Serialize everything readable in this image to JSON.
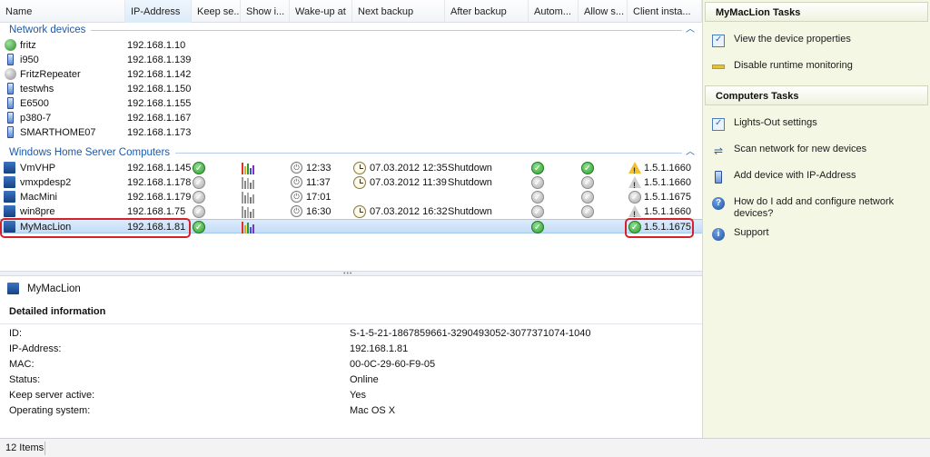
{
  "columns": [
    {
      "key": "name",
      "label": "Name"
    },
    {
      "key": "ip",
      "label": "IP-Address"
    },
    {
      "key": "keep",
      "label": "Keep se..."
    },
    {
      "key": "show",
      "label": "Show i..."
    },
    {
      "key": "wake",
      "label": "Wake-up at"
    },
    {
      "key": "next_backup",
      "label": "Next backup"
    },
    {
      "key": "after_backup",
      "label": "After backup"
    },
    {
      "key": "autom",
      "label": "Autom..."
    },
    {
      "key": "allow",
      "label": "Allow s..."
    },
    {
      "key": "client",
      "label": "Client insta..."
    }
  ],
  "sorted_column": "IP-Address",
  "groups": {
    "network": {
      "title": "Network devices",
      "rows": [
        {
          "name": "fritz",
          "ip": "192.168.1.10",
          "icon": "globe-device-icon"
        },
        {
          "name": "i950",
          "ip": "192.168.1.139",
          "icon": "device-icon"
        },
        {
          "name": "FritzRepeater",
          "ip": "192.168.1.142",
          "icon": "search-device-icon"
        },
        {
          "name": "testwhs",
          "ip": "192.168.1.150",
          "icon": "device-icon"
        },
        {
          "name": "E6500",
          "ip": "192.168.1.155",
          "icon": "device-icon"
        },
        {
          "name": "p380-7",
          "ip": "192.168.1.167",
          "icon": "device-icon"
        },
        {
          "name": "SMARTHOME07",
          "ip": "192.168.1.173",
          "icon": "device-icon"
        }
      ]
    },
    "whs": {
      "title": "Windows Home Server Computers",
      "rows": [
        {
          "name": "VmVHP",
          "ip": "192.168.1.145",
          "keep": "green",
          "show": "color",
          "wake": "12:33",
          "next_backup": "07.03.2012 12:35",
          "after_backup": "Shutdown",
          "autom": "green",
          "allow": "green",
          "client": "1.5.1.1660",
          "client_status": "warn"
        },
        {
          "name": "vmxpdesp2",
          "ip": "192.168.1.178",
          "keep": "gray",
          "show": "gray",
          "wake": "11:37",
          "next_backup": "07.03.2012 11:39",
          "after_backup": "Shutdown",
          "autom": "gray",
          "allow": "gray",
          "client": "1.5.1.1660",
          "client_status": "warn-gray"
        },
        {
          "name": "MacMini",
          "ip": "192.168.1.179",
          "keep": "gray",
          "show": "gray",
          "wake": "17:01",
          "next_backup": "",
          "after_backup": "",
          "autom": "gray",
          "allow": "gray",
          "client": "1.5.1.1675",
          "client_status": "gray"
        },
        {
          "name": "win8pre",
          "ip": "192.168.1.75",
          "keep": "gray",
          "show": "gray",
          "wake": "16:30",
          "next_backup": "07.03.2012 16:32",
          "after_backup": "Shutdown",
          "autom": "gray",
          "allow": "gray",
          "client": "1.5.1.1660",
          "client_status": "warn-gray"
        },
        {
          "name": "MyMacLion",
          "ip": "192.168.1.81",
          "keep": "green",
          "show": "color",
          "wake": "",
          "next_backup": "",
          "after_backup": "",
          "autom": "green",
          "allow": "",
          "client": "1.5.1.1675",
          "client_status": "green",
          "selected": true
        }
      ]
    }
  },
  "detail": {
    "title": "MyMacLion",
    "heading": "Detailed information",
    "fields": [
      {
        "label": "ID:",
        "value": "S-1-5-21-1867859661-3290493052-3077371074-1040"
      },
      {
        "label": "IP-Address:",
        "value": "192.168.1.81"
      },
      {
        "label": "MAC:",
        "value": "00-0C-29-60-F9-05"
      },
      {
        "label": "Status:",
        "value": "Online"
      },
      {
        "label": "Keep server active:",
        "value": "Yes"
      },
      {
        "label": "Operating system:",
        "value": "Mac OS X"
      }
    ]
  },
  "status_bar": {
    "items_text": "12 Items"
  },
  "tasks": {
    "device_section": {
      "title": "MyMacLion Tasks",
      "items": [
        {
          "label": "View the device properties",
          "icon": "properties-icon"
        },
        {
          "label": "Disable runtime monitoring",
          "icon": "monitor-bar-icon"
        }
      ]
    },
    "computers_section": {
      "title": "Computers Tasks",
      "items": [
        {
          "label": "Lights-Out settings",
          "icon": "settings-check-icon"
        },
        {
          "label": "Scan network for new devices",
          "icon": "scan-network-icon"
        },
        {
          "label": "Add device with IP-Address",
          "icon": "add-device-icon"
        },
        {
          "label": "How do I add and configure network devices?",
          "icon": "help-icon"
        },
        {
          "label": "Support",
          "icon": "info-icon"
        }
      ]
    }
  },
  "colors": {
    "accent": "#1d5aa8",
    "highlight": "#d2232a",
    "tasks_bg": "#f4f7e4",
    "selection": "#c4dcf6"
  }
}
